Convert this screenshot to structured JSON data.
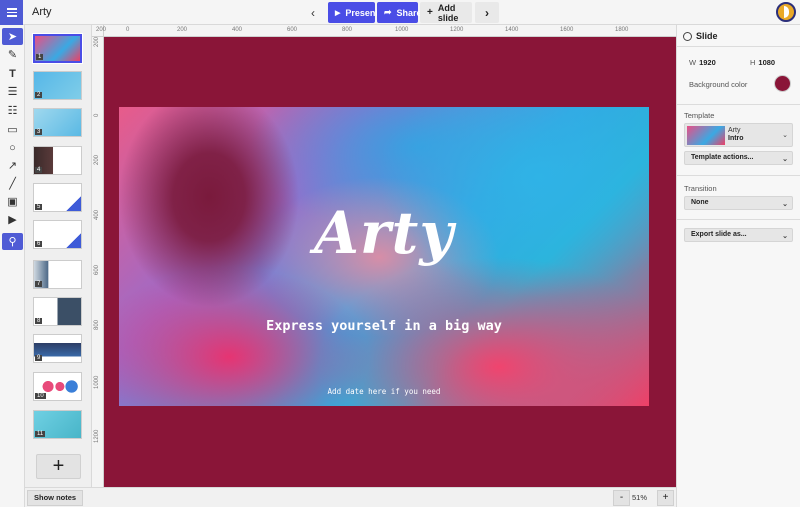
{
  "app": {
    "title": "Arty"
  },
  "header": {
    "present_label": "Present",
    "share_label": "Share",
    "add_slide_label": "Add slide",
    "prev_icon": "chevron-left-icon",
    "next_icon": "chevron-right-icon",
    "accent": "#4a4de6"
  },
  "toolbar": {
    "tools": [
      "select-arrow",
      "pen",
      "text",
      "numbered-list",
      "bullet-list",
      "rectangle",
      "ellipse",
      "arrow",
      "line",
      "image",
      "video",
      "search"
    ]
  },
  "thumbnails": {
    "numbers": [
      "1",
      "2",
      "3",
      "4",
      "5",
      "6",
      "7",
      "8",
      "9",
      "10",
      "11"
    ]
  },
  "ruler": {
    "top": [
      "200",
      "0",
      "200",
      "400",
      "600",
      "800",
      "1000",
      "1200",
      "1400",
      "1600",
      "1800"
    ],
    "left": [
      "200",
      "0",
      "200",
      "400",
      "600",
      "800",
      "1000",
      "1200"
    ]
  },
  "slide": {
    "title": "Arty",
    "subtitle": "Express yourself in a big way",
    "date_placeholder": "Add date here if you need",
    "background_color": "#8a1538"
  },
  "right_panel": {
    "heading": "Slide",
    "width_label": "W",
    "width_value": "1920",
    "height_label": "H",
    "height_value": "1080",
    "bg_color_label": "Background color",
    "template_label": "Template",
    "template_name": "Arty",
    "template_layout": "Intro",
    "template_actions_label": "Template actions...",
    "transition_label": "Transition",
    "transition_value": "None",
    "export_label": "Export slide as..."
  },
  "bottom": {
    "show_notes_label": "Show notes",
    "zoom_minus": "-",
    "zoom_value": "51%",
    "zoom_plus": "+"
  }
}
